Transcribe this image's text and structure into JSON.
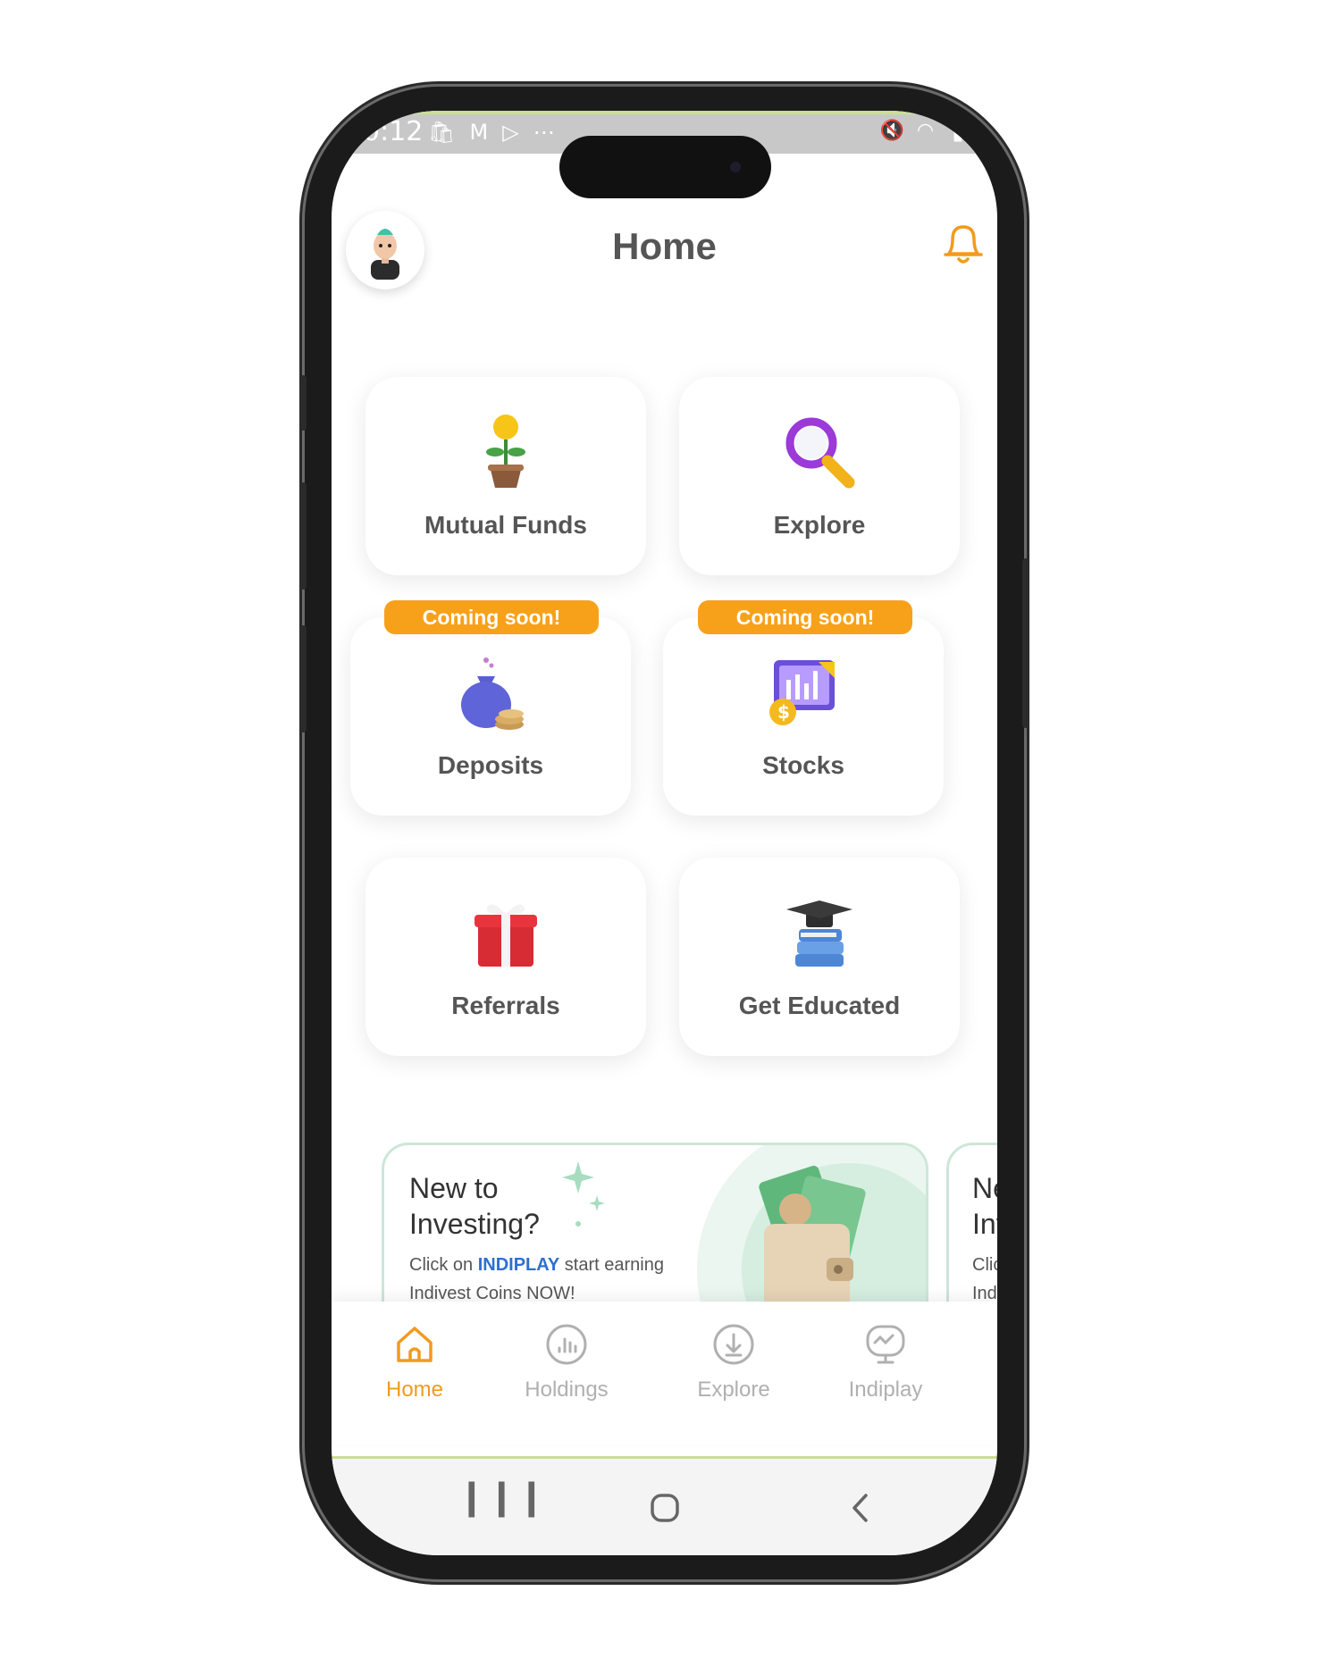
{
  "status_bar": {
    "time": "0:12"
  },
  "header": {
    "title": "Home"
  },
  "tiles": [
    {
      "label": "Mutual Funds",
      "icon": "plant-coin-icon"
    },
    {
      "label": "Explore",
      "icon": "magnifier-icon"
    },
    {
      "label": "Deposits",
      "icon": "money-bag-icon",
      "badge": "Coming soon!"
    },
    {
      "label": "Stocks",
      "icon": "stock-chart-icon",
      "badge": "Coming soon!"
    },
    {
      "label": "Referrals",
      "icon": "gift-icon"
    },
    {
      "label": "Get Educated",
      "icon": "books-graduation-cap-icon"
    }
  ],
  "banner": {
    "title": "New to Investing?",
    "desc_prefix": "Click on ",
    "desc_brand": "INDIPLAY",
    "desc_suffix": " start earning Indivest Coins NOW!"
  },
  "banner_peek": {
    "title_l1": "Ne",
    "title_l2": "Inv",
    "desc_l1": "Clic",
    "desc_l2": "Ind"
  },
  "bottom_nav": [
    {
      "label": "Home",
      "active": true
    },
    {
      "label": "Holdings",
      "active": false
    },
    {
      "label": "Explore",
      "active": false
    },
    {
      "label": "Indiplay",
      "active": false
    }
  ],
  "colors": {
    "accent": "#f29a1f",
    "badge": "#f7a11a",
    "brand_link": "#2e6fd1",
    "banner_green": "#cde6d8"
  }
}
